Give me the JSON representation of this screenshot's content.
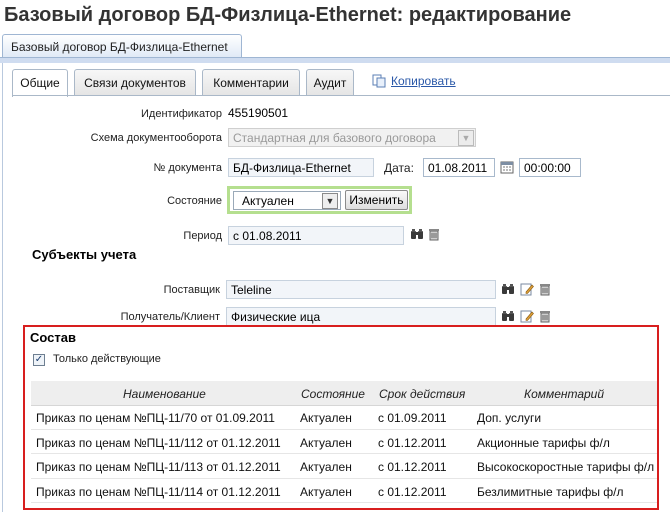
{
  "page": {
    "title": "Базовый договор БД-Физлица-Ethernet: редактирование"
  },
  "doc_tab": {
    "label": "Базовый договор БД-Физлица-Ethernet"
  },
  "tabs": [
    {
      "label": "Общие",
      "active": true
    },
    {
      "label": "Связи документов",
      "active": false
    },
    {
      "label": "Комментарии",
      "active": false
    },
    {
      "label": "Аудит",
      "active": false
    }
  ],
  "copy_link": "Копировать",
  "form": {
    "identifier": {
      "label": "Идентификатор",
      "value": "455190501"
    },
    "workflow": {
      "label": "Схема документооборота",
      "value": "Стандартная для базового договора"
    },
    "doc_number": {
      "label": "№ документа",
      "value": "БД-Физлица-Ethernet"
    },
    "date": {
      "label": "Дата:",
      "date_value": "01.08.2011",
      "time_value": "00:00:00"
    },
    "state": {
      "label": "Состояние",
      "value": "Актуален",
      "change_button": "Изменить"
    },
    "period": {
      "label": "Период",
      "value": "с 01.08.2011"
    }
  },
  "subjects": {
    "title": "Субъекты учета",
    "supplier": {
      "label": "Поставщик",
      "value": "Teleline"
    },
    "recipient": {
      "label": "Получатель/Клиент",
      "value": "Физические ица"
    }
  },
  "composition": {
    "title": "Состав",
    "only_active_label": "Только действующие",
    "only_active_checked": true,
    "columns": [
      "Наименование",
      "Состояние",
      "Срок действия",
      "Комментарий"
    ],
    "rows": [
      [
        "Приказ по ценам №ПЦ-11/70 от 01.09.2011",
        "Актуален",
        "с 01.09.2011",
        "Доп. услуги"
      ],
      [
        "Приказ по ценам №ПЦ-11/112 от 01.12.2011",
        "Актуален",
        "с 01.12.2011",
        "Акционные тарифы ф/л"
      ],
      [
        "Приказ по ценам №ПЦ-11/113 от 01.12.2011",
        "Актуален",
        "с 01.12.2011",
        "Высокоскоростные тарифы ф/л"
      ],
      [
        "Приказ по ценам №ПЦ-11/114 от 01.12.2011",
        "Актуален",
        "с 01.12.2011",
        "Безлимитные тарифы ф/л"
      ]
    ]
  },
  "colors": {
    "highlight_green": "#b5df8f",
    "highlight_red": "#d81e1e",
    "link": "#2a58a8"
  }
}
